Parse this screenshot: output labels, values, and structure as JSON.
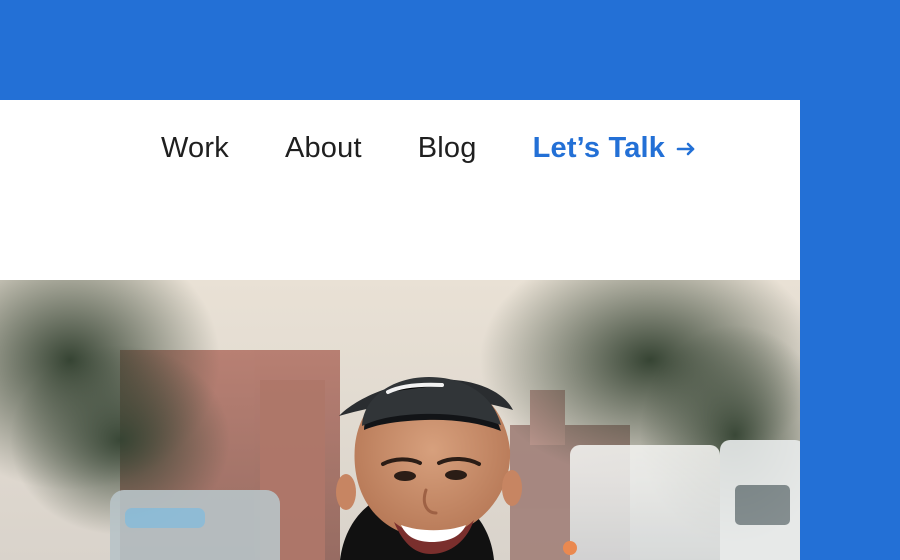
{
  "nav": {
    "items": [
      {
        "label": "Work"
      },
      {
        "label": "About"
      },
      {
        "label": "Blog"
      }
    ],
    "cta": {
      "label": "Let’s Talk",
      "icon": "arrow-right-icon"
    }
  },
  "hero": {
    "image": "portrait-photo"
  },
  "colors": {
    "background": "#2370d6",
    "panel": "#ffffff",
    "accent": "#2370d6",
    "text": "#1f1f1f"
  }
}
